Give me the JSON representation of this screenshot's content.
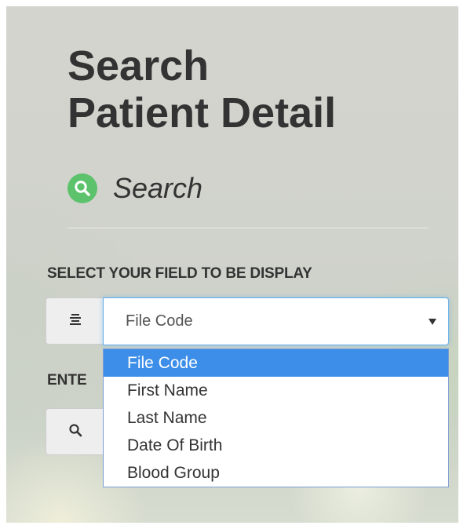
{
  "page": {
    "title_line1": "Search",
    "title_line2": "Patient Detail",
    "subtitle": "Search"
  },
  "form": {
    "field_select_label": "SELECT YOUR FIELD TO BE DISPLAY",
    "selected_field": "File Code",
    "field_options": [
      "File Code",
      "First Name",
      "Last Name",
      "Date Of Birth",
      "Blood Group"
    ],
    "enter_label_visible": "ENTE",
    "search_value": ""
  },
  "icons": {
    "subtitle_icon": "search-icon",
    "select_addon_icon": "list-icon",
    "select_arrow_icon": "caret-down-icon",
    "search_addon_icon": "search-icon"
  },
  "colors": {
    "badge_green": "#5cc26b",
    "highlight_blue": "#3d8ee8",
    "focus_blue": "#66afe9",
    "text": "#333333"
  }
}
